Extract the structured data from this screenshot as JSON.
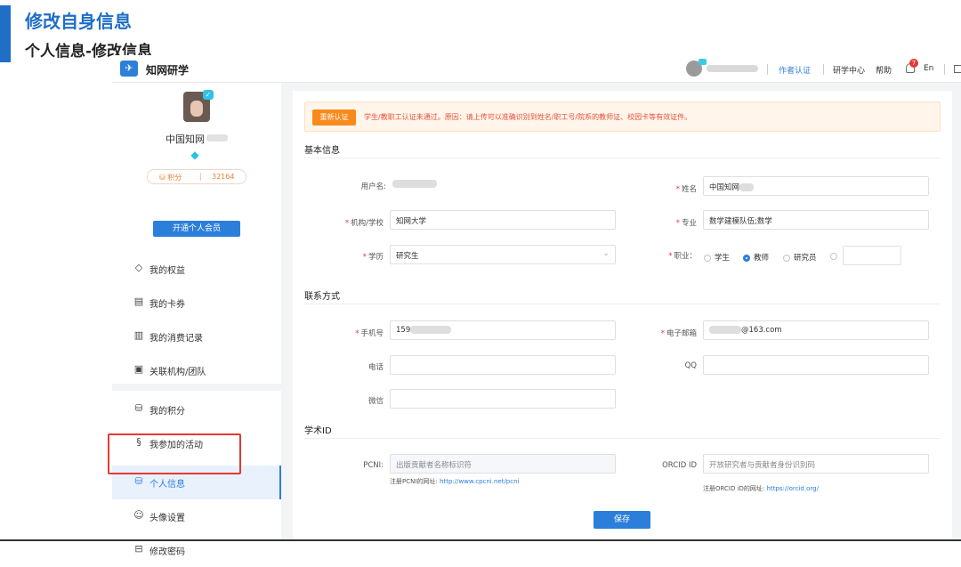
{
  "slide": {
    "title": "修改自身信息",
    "subtitle": "个人信息-修改信息"
  },
  "topbar": {
    "brand": "知网研学",
    "author_cert": "作者认证",
    "research_center": "研学中心",
    "help": "帮助",
    "notif_count": "7",
    "lang": "En"
  },
  "profile": {
    "name": "中国知网",
    "points_label": "积分",
    "points_value": "32164",
    "vip_button": "开通个人会员"
  },
  "menu": {
    "items": [
      {
        "label": "我的权益",
        "icon": "diamond-icon"
      },
      {
        "label": "我的卡券",
        "icon": "ticket-icon"
      },
      {
        "label": "我的消费记录",
        "icon": "receipt-icon"
      },
      {
        "label": "关联机构/团队",
        "icon": "org-icon"
      },
      {
        "label": "我的积分",
        "icon": "coins-icon"
      },
      {
        "label": "我参加的活动",
        "icon": "activity-icon"
      },
      {
        "label": "个人信息",
        "icon": "coins-icon"
      },
      {
        "label": "头像设置",
        "icon": "user-circle-icon"
      },
      {
        "label": "修改密码",
        "icon": "lock-icon"
      }
    ]
  },
  "alert": {
    "button": "重新认证",
    "text": "学生/教职工认证未通过。原因：请上传可以准确识别到姓名/职工号/院系的教师证、校园卡等有效证件。"
  },
  "basic": {
    "section_title": "基本信息",
    "username_label": "用户名:",
    "name_label": "姓名",
    "name_value": "中国知网",
    "org_label": "机构/学校",
    "org_value": "知网大学",
    "major_label": "专业",
    "major_value": "数学建模队伍;数学",
    "edu_label": "学历",
    "edu_value": "研究生",
    "job_label": "职业：",
    "job_options": [
      "学生",
      "教师",
      "研究员"
    ],
    "job_selected": "教师"
  },
  "contact": {
    "section_title": "联系方式",
    "phone_label": "手机号",
    "phone_value": "159",
    "email_label": "电子邮箱",
    "email_value": "@163.com",
    "tel_label": "电话",
    "qq_label": "QQ",
    "wechat_label": "微信"
  },
  "scholar": {
    "section_title": "学术ID",
    "pcni_label": "PCNI:",
    "pcni_placeholder": "出版贡献者名称标识符",
    "pcni_hint": "注册PCNI的网址:",
    "pcni_url": "http://www.cpcni.net/pcni",
    "orcid_label": "ORCID ID",
    "orcid_placeholder": "开放研究者与贡献者身份识别码",
    "orcid_hint": "注册ORCID iD的网址:",
    "orcid_url": "https://orcid.org/"
  },
  "save_button": "保存",
  "colors": {
    "primary": "#2b7fdb",
    "title_blue": "#1f6fc7",
    "warn_orange": "#f98a1c",
    "error_red": "#e53935"
  }
}
